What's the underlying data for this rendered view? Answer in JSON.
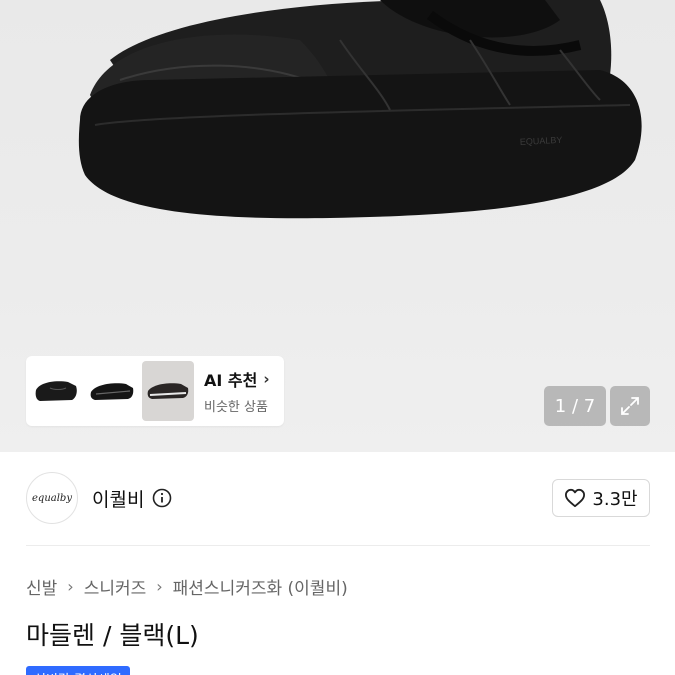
{
  "gallery": {
    "ai_title": "AI 추천",
    "ai_chevron": "›",
    "ai_subtitle": "비슷한 상품",
    "counter": "1 / 7",
    "expand_icon": "expand-icon"
  },
  "seller": {
    "logo_text": "equalby",
    "name": "이퀄비",
    "info_icon": "info-icon",
    "like_icon": "heart-icon",
    "like_count": "3.3만"
  },
  "breadcrumb": {
    "items": [
      "신발",
      "스니커즈",
      "패션스니커즈화 (이퀄비)"
    ],
    "separator": "›"
  },
  "product": {
    "title": "마들렌 / 블랙(L)",
    "badge": "신비감 결산세일"
  },
  "colors": {
    "accent": "#2f6bff",
    "shoe": "#1a1a1a"
  }
}
